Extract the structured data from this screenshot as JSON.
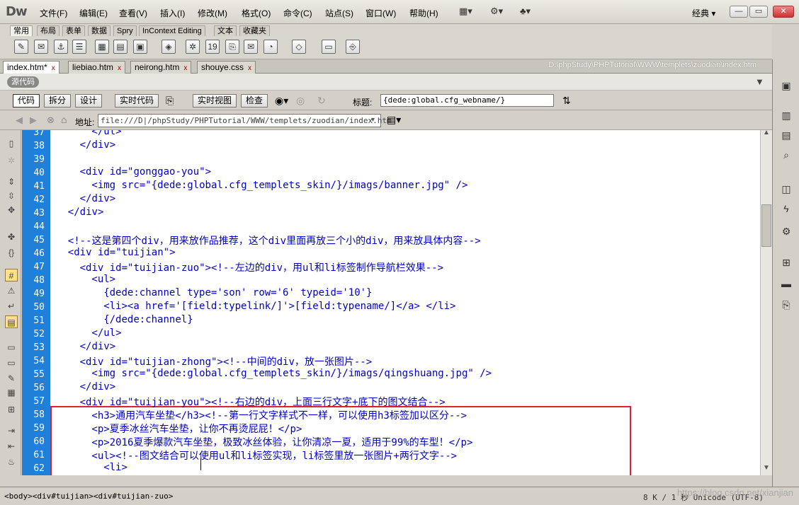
{
  "app": {
    "logo": "Dw",
    "menus": [
      "文件(F)",
      "编辑(E)",
      "查看(V)",
      "插入(I)",
      "修改(M)",
      "格式(O)",
      "命令(C)",
      "站点(S)",
      "窗口(W)",
      "帮助(H)"
    ],
    "workspace": "经典 ▾",
    "win_min": "—",
    "win_max": "▭",
    "win_close": "✕"
  },
  "insert_tabs": [
    "常用",
    "布局",
    "表单",
    "数据",
    "Spry",
    "InContext Editing",
    "文本",
    "收藏夹"
  ],
  "doc_tabs": [
    "index.htm*",
    "liebiao.htm",
    "neirong.htm",
    "shouye.css"
  ],
  "doc_tab_close": "x",
  "file_path": "D:\\phpStudy\\PHPTutorial\\WWW\\templets\\zuodian\\index.htm",
  "source_badge": "源代码",
  "view_buttons": {
    "code": "代码",
    "split": "拆分",
    "design": "设计",
    "live_code": "实时代码",
    "live_view": "实时视图",
    "inspect": "检查"
  },
  "title_label": "标题:",
  "title_value": "{dede:global.cfg_webname/}",
  "address_label": "地址:",
  "address_value": "file:///D|/phpStudy/PHPTutorial/WWW/templets/zuodian/index.htm",
  "code_lines": [
    {
      "n": "37",
      "i": 6,
      "t": "</ul>"
    },
    {
      "n": "38",
      "i": 4,
      "t": "</div>"
    },
    {
      "n": "39",
      "i": 0,
      "t": ""
    },
    {
      "n": "40",
      "i": 4,
      "t": "<div id=\"gonggao-you\">"
    },
    {
      "n": "41",
      "i": 6,
      "t": "<img src=\"{dede:global.cfg_templets_skin/}/imags/banner.jpg\" />"
    },
    {
      "n": "42",
      "i": 4,
      "t": "</div>"
    },
    {
      "n": "43",
      "i": 2,
      "t": "</div>"
    },
    {
      "n": "44",
      "i": 0,
      "t": ""
    },
    {
      "n": "45",
      "i": 2,
      "t": "<!--这是第四个div，用来放作品推荐，这个div里面再放三个小的div，用来放具体内容-->",
      "c": "cm"
    },
    {
      "n": "46",
      "i": 2,
      "t": "<div id=\"tuijian\">"
    },
    {
      "n": "47",
      "i": 4,
      "t": "<div id=\"tuijian-zuo\"><!--左边的div，用ul和li标签制作导航栏效果-->"
    },
    {
      "n": "48",
      "i": 6,
      "t": "<ul>"
    },
    {
      "n": "49",
      "i": 8,
      "t": "{dede:channel type='son' row='6' typeid='10'}",
      "c": "tx"
    },
    {
      "n": "50",
      "i": 8,
      "t": "<li><a href='[field:typelink/]'>[field:typename/]</a> </li>"
    },
    {
      "n": "51",
      "i": 8,
      "t": "{/dede:channel}",
      "c": "tx"
    },
    {
      "n": "52",
      "i": 6,
      "t": "</ul>"
    },
    {
      "n": "53",
      "i": 4,
      "t": "</div>"
    },
    {
      "n": "54",
      "i": 4,
      "t": "<div id=\"tuijian-zhong\"><!--中间的div，放一张图片-->"
    },
    {
      "n": "55",
      "i": 6,
      "t": "<img src=\"{dede:global.cfg_templets_skin/}/imags/qingshuang.jpg\" />"
    },
    {
      "n": "56",
      "i": 4,
      "t": "</div>"
    },
    {
      "n": "57",
      "i": 4,
      "t": "<div id=\"tuijian-you\"><!--右边的div，上面三行文字+底下的图文结合-->"
    },
    {
      "n": "58",
      "i": 6,
      "t": "<h3>通用汽车坐垫</h3><!--第一行文字样式不一样，可以使用h3标签加以区分-->"
    },
    {
      "n": "59",
      "i": 6,
      "t": "<p>夏季冰丝汽车坐垫，让你不再烫屁屁！</p>"
    },
    {
      "n": "60",
      "i": 6,
      "t": "<p>2016夏季爆款汽车坐垫，极致冰丝体验，让你清凉一夏，适用于99%的车型！</p>"
    },
    {
      "n": "61",
      "i": 6,
      "t": "<ul><!--图文结合可以使用ul和li标签实现，li标签里放一张图片+两行文字-->"
    },
    {
      "n": "62",
      "i": 8,
      "t": "<li>"
    }
  ],
  "status": {
    "breadcrumb": "<body><div#tuijian><div#tuijian-zuo>",
    "info": "8 K / 1 秒  Unicode (UTF-8)",
    "watermark": "https://blog.csdn.net/xianjian"
  }
}
